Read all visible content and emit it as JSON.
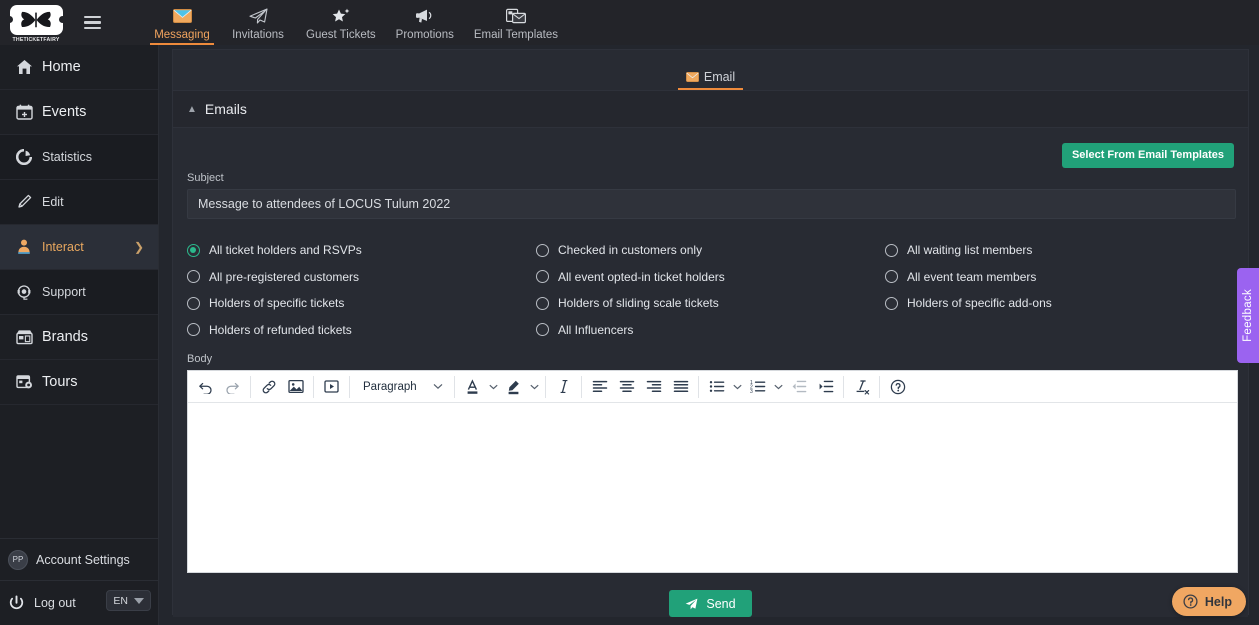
{
  "brand": {
    "logo_text": "THETICKETFAIRY",
    "accent_orange": "#ef8b3c",
    "accent_green": "#21a179",
    "accent_purple": "#9b63f0",
    "radio_selected_color": "#2bb98c"
  },
  "topnav": {
    "menu_icon": "hamburger-icon",
    "items": [
      {
        "label": "Messaging",
        "icon": "envelope-icon",
        "active": true
      },
      {
        "label": "Invitations",
        "icon": "paper-plane-icon",
        "active": false
      },
      {
        "label": "Guest Tickets",
        "icon": "star-sparkle-icon",
        "active": false
      },
      {
        "label": "Promotions",
        "icon": "megaphone-icon",
        "active": false
      },
      {
        "label": "Email Templates",
        "icon": "mail-template-icon",
        "active": false
      }
    ]
  },
  "sidebar": {
    "items": [
      {
        "label": "Home",
        "icon": "home-icon",
        "size": "big",
        "selected": false,
        "chevron": false
      },
      {
        "label": "Events",
        "icon": "calendar-icon",
        "size": "big",
        "selected": false,
        "chevron": false
      },
      {
        "label": "Statistics",
        "icon": "pie-chart-icon",
        "size": "sub",
        "selected": false,
        "chevron": false
      },
      {
        "label": "Edit",
        "icon": "pencil-icon",
        "size": "sub",
        "selected": false,
        "chevron": false
      },
      {
        "label": "Interact",
        "icon": "user-interact-icon",
        "size": "sub",
        "selected": true,
        "chevron": true
      },
      {
        "label": "Support",
        "icon": "headset-icon",
        "size": "sub",
        "selected": false,
        "chevron": false
      },
      {
        "label": "Brands",
        "icon": "store-icon",
        "size": "big",
        "selected": false,
        "chevron": false
      },
      {
        "label": "Tours",
        "icon": "tour-map-icon",
        "size": "big",
        "selected": false,
        "chevron": false
      }
    ],
    "account": {
      "initials": "PP",
      "label": "Account Settings"
    },
    "logout": {
      "label": "Log out",
      "icon": "power-icon"
    },
    "language": {
      "value": "EN",
      "icon": "chevron-down-icon"
    }
  },
  "main": {
    "tabs": [
      {
        "label": "Email",
        "icon": "envelope-icon",
        "active": true
      }
    ],
    "section": {
      "title": "Emails",
      "collapse_icon": "chevron-up-icon"
    },
    "template_button": "Select From Email Templates",
    "subject": {
      "label": "Subject",
      "value": "Message to attendees of LOCUS Tulum 2022",
      "placeholder": "Subject"
    },
    "recipients": {
      "columns": [
        [
          {
            "label": "All ticket holders and RSVPs",
            "selected": true
          },
          {
            "label": "All pre-registered customers",
            "selected": false
          },
          {
            "label": "Holders of specific tickets",
            "selected": false
          },
          {
            "label": "Holders of refunded tickets",
            "selected": false
          }
        ],
        [
          {
            "label": "Checked in customers only",
            "selected": false
          },
          {
            "label": "All event opted-in ticket holders",
            "selected": false
          },
          {
            "label": "Holders of sliding scale tickets",
            "selected": false
          },
          {
            "label": "All Influencers",
            "selected": false
          }
        ],
        [
          {
            "label": "All waiting list members",
            "selected": false
          },
          {
            "label": "All event team members",
            "selected": false
          },
          {
            "label": "Holders of specific add-ons",
            "selected": false
          }
        ]
      ]
    },
    "body": {
      "label": "Body",
      "content": "",
      "toolbar": {
        "block_format": "Paragraph",
        "buttons": [
          "undo-icon",
          "redo-icon",
          "link-icon",
          "image-icon",
          "media-icon",
          "text-color-icon",
          "highlight-color-icon",
          "italic-icon",
          "align-left-icon",
          "align-center-icon",
          "align-right-icon",
          "align-justify-icon",
          "bullet-list-icon",
          "numbered-list-icon",
          "outdent-icon",
          "indent-icon",
          "clear-formatting-icon",
          "help-icon"
        ]
      }
    },
    "send_button": {
      "label": "Send",
      "icon": "paper-plane-icon"
    }
  },
  "widgets": {
    "feedback": "Feedback",
    "help": {
      "label": "Help",
      "icon": "question-circle-icon"
    }
  }
}
